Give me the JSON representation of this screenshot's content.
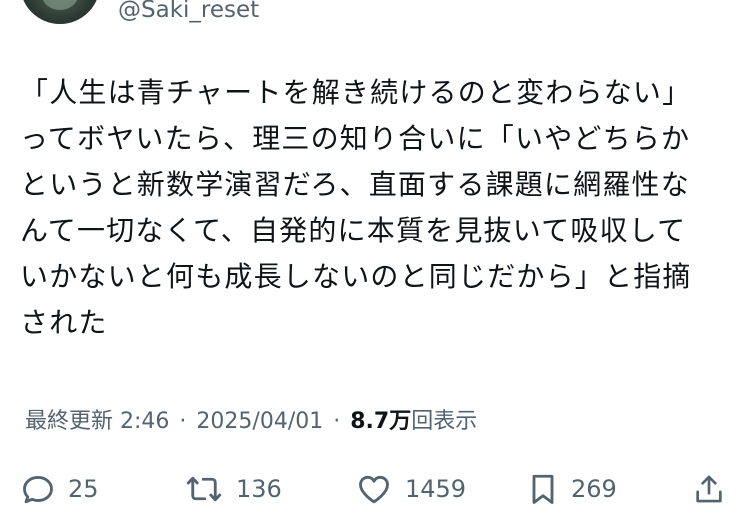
{
  "user": {
    "handle": "@Saki_reset"
  },
  "tweet": {
    "lines": [
      "「人生は青チャートを解き続けるのと変わらない」",
      "ってボヤいたら、理三の知り合いに「いやどちらか",
      "というと新数学演習だろ、直面する課題に網羅性な",
      "んて一切なくて、自発的に本質を見抜いて吸収して",
      "いかないと何も成長しないのと同じだから」と指摘",
      "された"
    ]
  },
  "meta": {
    "label": "最終更新",
    "time": "2:46",
    "separator": "·",
    "date": "2025/04/01",
    "views_count": "8.7万",
    "views_label": "回表示"
  },
  "actions": {
    "reply_count": "25",
    "retweet_count": "136",
    "like_count": "1459",
    "bookmark_count": "269"
  },
  "icons": {
    "reply": "reply-icon",
    "retweet": "retweet-icon",
    "like": "heart-icon",
    "bookmark": "bookmark-icon",
    "share": "share-icon"
  },
  "colors": {
    "text": "#0f1419",
    "secondary": "#536471",
    "background": "#ffffff"
  }
}
